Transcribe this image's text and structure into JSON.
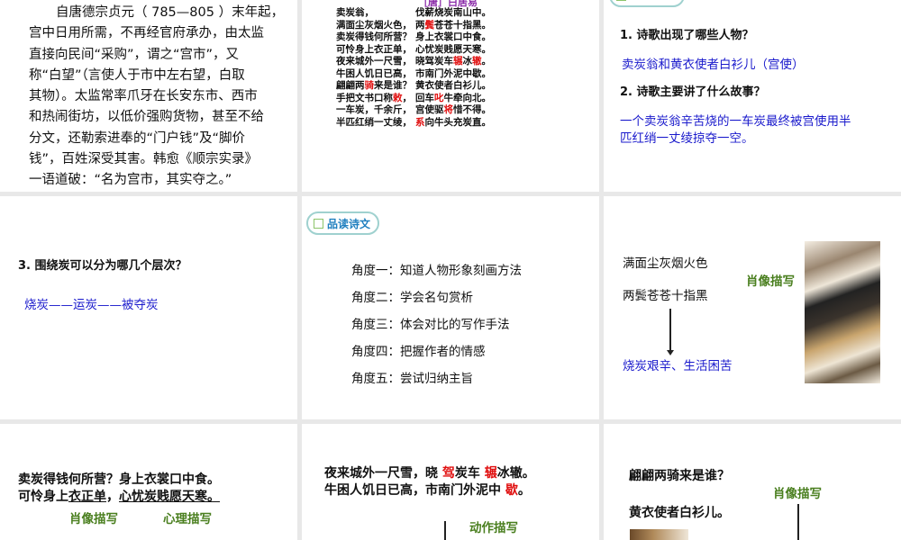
{
  "slides": [
    {
      "paragraph_lines": [
        "自唐德宗贞元（ 785—805 ）末年起，",
        "宫中日用所需，不再经官府承办，由太监",
        "直接向民间“采购”，谓之“宫市”，又",
        "称“白望”（言使人于市中左右望，白取",
        "其物）。太监常率爪牙在长安东市、西市",
        "和热闹街坊，以低价强购货物，甚至不给",
        "分文，还勒索进奉的“门户钱”及“脚价",
        "钱”，百姓深受其害。韩愈《顺宗实录》",
        "一语道破：“名为宫市，其实夺之。”"
      ]
    },
    {
      "author": "［唐］白居易",
      "poem_lines": [
        [
          {
            "t": "卖炭翁，"
          },
          {
            "t": "伐薪烧炭南山中。"
          }
        ],
        [
          {
            "t": "满面尘灰烟火色，"
          },
          {
            "t": "两"
          },
          {
            "t": "鬓",
            "r": 1
          },
          {
            "t": "苍苍十指黑。"
          }
        ],
        [
          {
            "t": "卖炭得钱何所营？"
          },
          {
            "t": "身上衣裳口中食。"
          }
        ],
        [
          {
            "t": "可怜身上衣正单，"
          },
          {
            "t": "心忧炭贱愿天寒。"
          }
        ],
        [
          {
            "t": "夜来城外一尺雪，"
          },
          {
            "t": "晓驾炭车"
          },
          {
            "t": "辗",
            "r": 1
          },
          {
            "t": "冰"
          },
          {
            "t": "辙",
            "r": 1
          },
          {
            "t": "。"
          }
        ],
        [
          {
            "t": "牛困人饥日已高，"
          },
          {
            "t": "市南门外泥中歇。"
          }
        ],
        [
          {
            "t": "翩翩两"
          },
          {
            "t": "骑",
            "r": 1
          },
          {
            "t": "来是谁？"
          },
          {
            "t": "黄衣使者白衫儿。"
          }
        ],
        [
          {
            "t": "手把文书口称"
          },
          {
            "t": "敕",
            "r": 1
          },
          {
            "t": "，"
          },
          {
            "t": "回车"
          },
          {
            "t": "叱",
            "r": 1
          },
          {
            "t": "牛牵向北。"
          }
        ],
        [
          {
            "t": "一车炭，千余斤，"
          },
          {
            "t": "宫使驱"
          },
          {
            "t": "将",
            "r": 1
          },
          {
            "t": "惜不得。"
          }
        ],
        [
          {
            "t": "半匹红绡一丈绫，"
          },
          {
            "t": "系",
            "r": 1
          },
          {
            "t": "向牛头充炭直。"
          }
        ]
      ]
    },
    {
      "q1": "1. 诗歌出现了哪些人物？",
      "a1": "卖炭翁和黄衣使者白衫儿（宫使）",
      "q2": "2. 诗歌主要讲了什么故事？",
      "a2_lines": [
        "一个卖炭翁辛苦烧的一车炭最终被宫使用半",
        "匹红绡一丈绫掠夺一空。"
      ]
    },
    {
      "q3": "3. 围绕炭可以分为哪几个层次？",
      "a3": "烧炭——运炭——被夺炭"
    },
    {
      "badge": "品读诗文",
      "angles": [
        "角度一：知道人物形象刻画方法",
        "角度二：学会名句赏析",
        "角度三：体会对比的写作手法",
        "角度四：把握作者的情感",
        "角度五：尝试归纳主旨"
      ]
    },
    {
      "line1": "满面尘灰烟火色",
      "line2": "两鬓苍苍十指黑",
      "result": "烧炭艰辛、生活困苦",
      "label": "肖像描写"
    },
    {
      "line1": "卖炭得钱何所营？身上衣裳口中食。",
      "line2_plain": "可怜身上",
      "line2_u1": "衣正单",
      "line2_sep": "，",
      "line2_u2": "心忧炭贱愿天寒。",
      "label1": "肖像描写",
      "label2": "心理描写"
    },
    {
      "line1": [
        {
          "t": "夜来城外一尺雪，晓 "
        },
        {
          "t": "驾",
          "r": 1
        },
        {
          "t": "炭车 "
        },
        {
          "t": "辗",
          "r": 1
        },
        {
          "t": "冰辙。"
        }
      ],
      "line2": [
        {
          "t": "牛困人饥日已高，市南门外泥中 "
        },
        {
          "t": "歇",
          "r": 1
        },
        {
          "t": "。"
        }
      ],
      "label": "动作描写"
    },
    {
      "line1": "翩翩两骑来是谁？",
      "line2": "黄衣使者白衫儿。",
      "label": "肖像描写"
    }
  ],
  "colors": {
    "answer": "#1a1acc",
    "label": "#4a7f1f",
    "highlight": "#e01010",
    "author": "#8a2aa8"
  }
}
